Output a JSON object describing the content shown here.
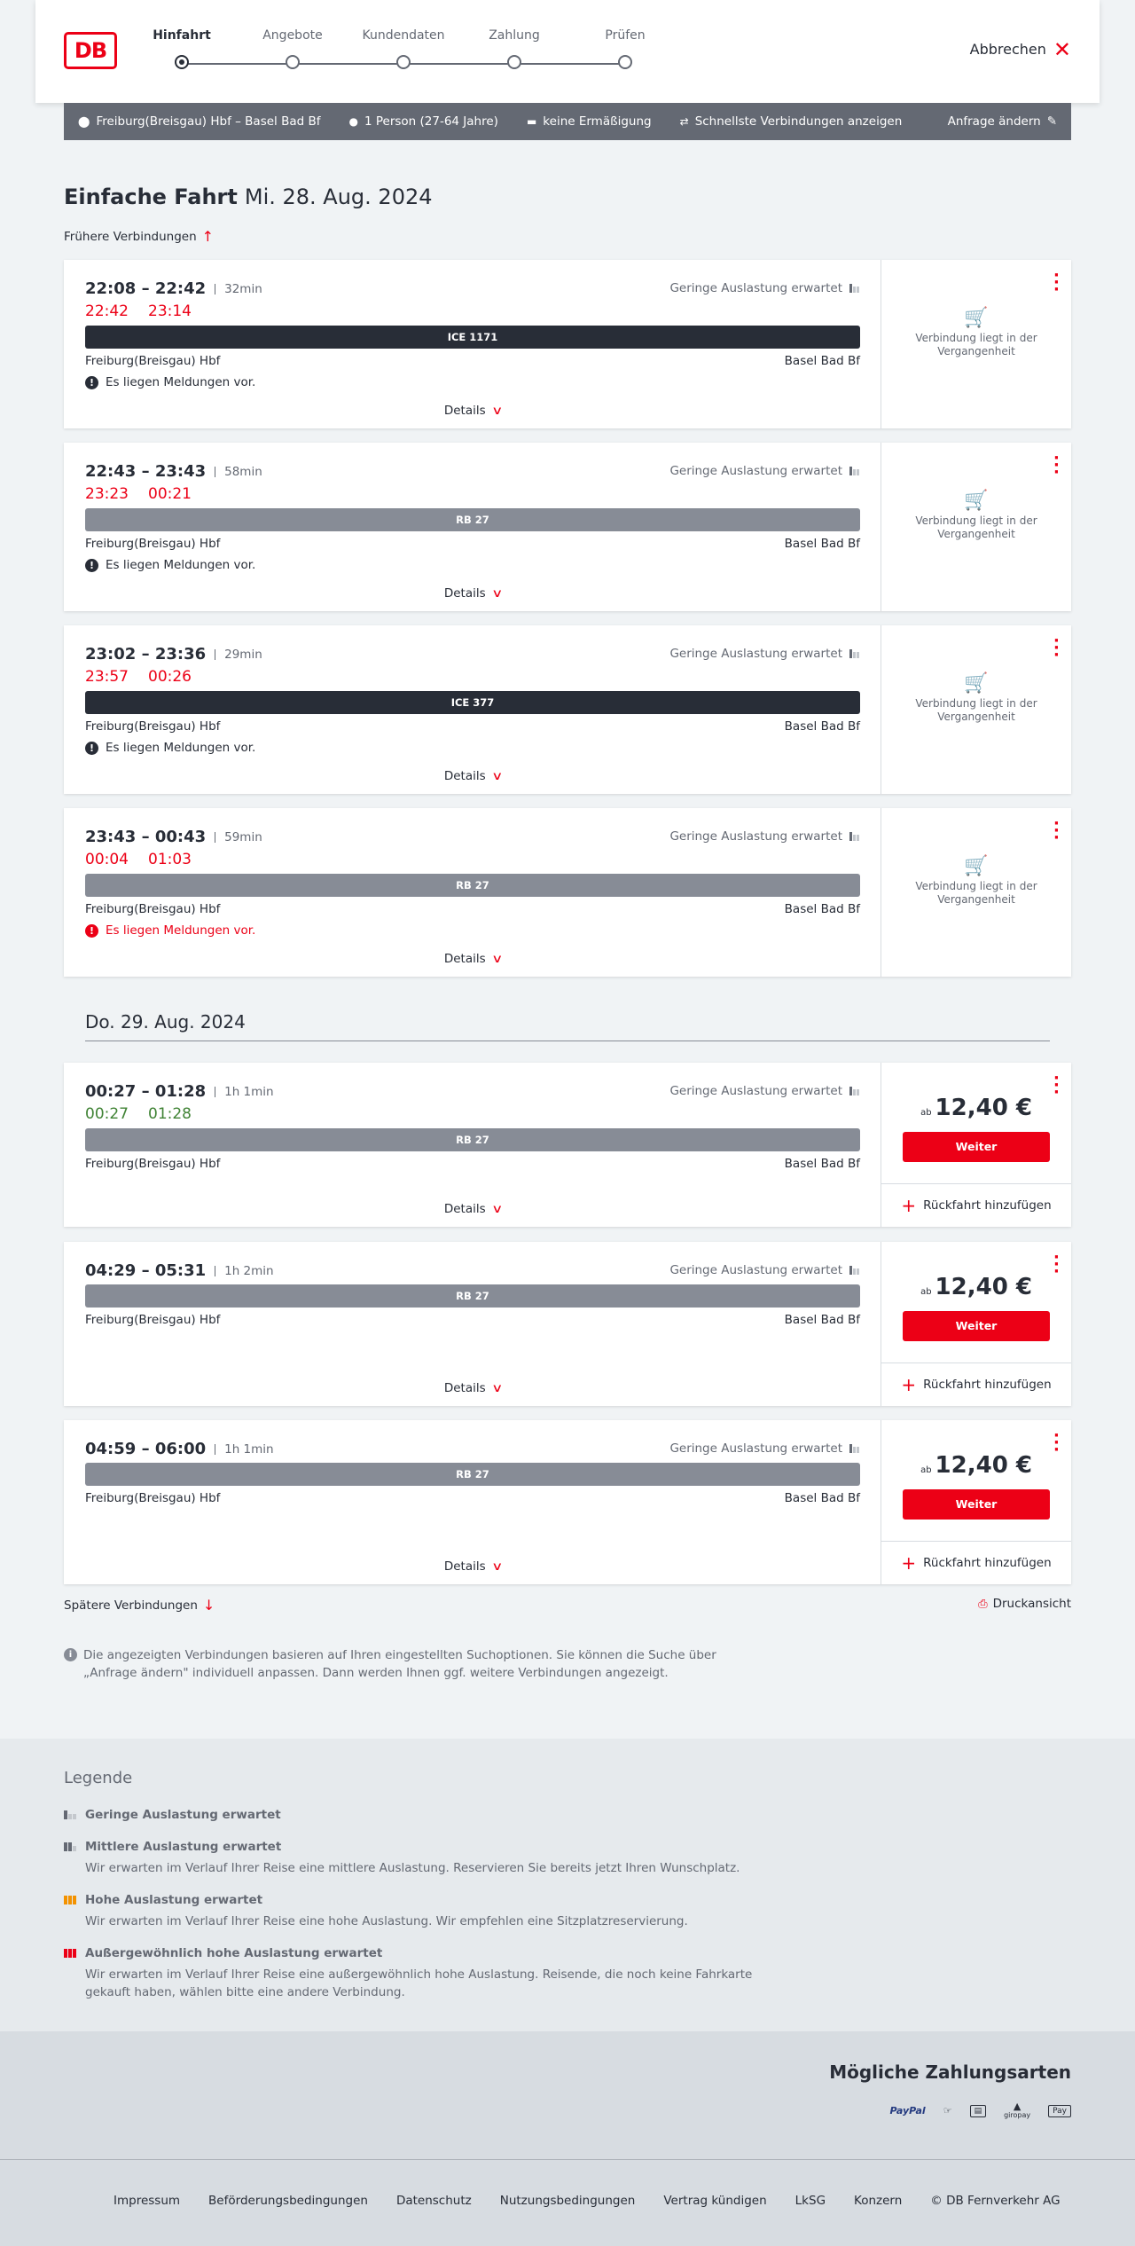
{
  "header": {
    "logo": "DB",
    "steps": [
      {
        "label": "Hinfahrt",
        "active": true
      },
      {
        "label": "Angebote",
        "active": false
      },
      {
        "label": "Kundendaten",
        "active": false
      },
      {
        "label": "Zahlung",
        "active": false
      },
      {
        "label": "Prüfen",
        "active": false
      }
    ],
    "cancel_label": "Abbrechen"
  },
  "search": {
    "route": "Freiburg(Breisgau) Hbf – Basel Bad Bf",
    "passengers": "1 Person (27-64 Jahre)",
    "discount": "keine Ermäßigung",
    "option": "Schnellste Verbindungen anzeigen",
    "edit_label": "Anfrage ändern"
  },
  "page": {
    "title_bold": "Einfache Fahrt",
    "title_date": "Mi. 28. Aug. 2024",
    "earlier_label": "Frühere Verbindungen",
    "date_separator": "Do. 29. Aug. 2024",
    "later_label": "Spätere Verbindungen",
    "print_label": "Druckansicht",
    "info_text": "Die angezeigten Verbindungen basieren auf Ihren eingestellten Suchoptionen. Sie können die Suche über „Anfrage ändern\" individuell anpassen. Dann werden Ihnen ggf. weitere Verbindungen angezeigt."
  },
  "connections": [
    {
      "times": "22:08 – 22:42",
      "duration": "32min",
      "rt_dep": "22:42",
      "rt_arr": "23:14",
      "rt_status": "late",
      "load": "Geringe Auslastung erwartet",
      "train": "ICE 1171",
      "train_style": "dark",
      "from": "Freiburg(Breisgau) Hbf",
      "to": "Basel Bad Bf",
      "message": "Es liegen Meldungen vor.",
      "message_red": false,
      "details": "Details",
      "past": "Verbindung liegt in der Vergangenheit"
    },
    {
      "times": "22:43 – 23:43",
      "duration": "58min",
      "rt_dep": "23:23",
      "rt_arr": "00:21",
      "rt_status": "late",
      "load": "Geringe Auslastung erwartet",
      "train": "RB 27",
      "train_style": "grey",
      "from": "Freiburg(Breisgau) Hbf",
      "to": "Basel Bad Bf",
      "message": "Es liegen Meldungen vor.",
      "message_red": false,
      "details": "Details",
      "past": "Verbindung liegt in der Vergangenheit"
    },
    {
      "times": "23:02 – 23:36",
      "duration": "29min",
      "rt_dep": "23:57",
      "rt_arr": "00:26",
      "rt_status": "late",
      "load": "Geringe Auslastung erwartet",
      "train": "ICE 377",
      "train_style": "dark",
      "from": "Freiburg(Breisgau) Hbf",
      "to": "Basel Bad Bf",
      "message": "Es liegen Meldungen vor.",
      "message_red": false,
      "details": "Details",
      "past": "Verbindung liegt in der Vergangenheit"
    },
    {
      "times": "23:43 – 00:43",
      "duration": "59min",
      "rt_dep": "00:04",
      "rt_arr": "01:03",
      "rt_status": "late",
      "load": "Geringe Auslastung erwartet",
      "train": "RB 27",
      "train_style": "grey",
      "from": "Freiburg(Breisgau) Hbf",
      "to": "Basel Bad Bf",
      "message": "Es liegen Meldungen vor.",
      "message_red": true,
      "details": "Details",
      "past": "Verbindung liegt in der Vergangenheit"
    },
    {
      "times": "00:27 – 01:28",
      "duration": "1h 1min",
      "rt_dep": "00:27",
      "rt_arr": "01:28",
      "rt_status": "ontime",
      "load": "Geringe Auslastung erwartet",
      "train": "RB 27",
      "train_style": "grey",
      "from": "Freiburg(Breisgau) Hbf",
      "to": "Basel Bad Bf",
      "details": "Details",
      "price_prefix": "ab",
      "price": "12,40 €",
      "button": "Weiter",
      "return": "Rückfahrt hinzufügen"
    },
    {
      "times": "04:29 – 05:31",
      "duration": "1h 2min",
      "load": "Geringe Auslastung erwartet",
      "train": "RB 27",
      "train_style": "grey",
      "from": "Freiburg(Breisgau) Hbf",
      "to": "Basel Bad Bf",
      "details": "Details",
      "price_prefix": "ab",
      "price": "12,40 €",
      "button": "Weiter",
      "return": "Rückfahrt hinzufügen"
    },
    {
      "times": "04:59 – 06:00",
      "duration": "1h 1min",
      "load": "Geringe Auslastung erwartet",
      "train": "RB 27",
      "train_style": "grey",
      "from": "Freiburg(Breisgau) Hbf",
      "to": "Basel Bad Bf",
      "details": "Details",
      "price_prefix": "ab",
      "price": "12,40 €",
      "button": "Weiter",
      "return": "Rückfahrt hinzufügen"
    }
  ],
  "legend": {
    "title": "Legende",
    "items": [
      {
        "title": "Geringe Auslastung erwartet",
        "desc": "",
        "color": "#646973"
      },
      {
        "title": "Mittlere Auslastung erwartet",
        "desc": "Wir erwarten im Verlauf Ihrer Reise eine mittlere Auslastung. Reservieren Sie bereits jetzt Ihren Wunschplatz.",
        "color": "#646973"
      },
      {
        "title": "Hohe Auslastung erwartet",
        "desc": "Wir erwarten im Verlauf Ihrer Reise eine hohe Auslastung. Wir empfehlen eine Sitzplatzreservierung.",
        "color": "#f39200"
      },
      {
        "title": "Außergewöhnlich hohe Auslastung erwartet",
        "desc": "Wir erwarten im Verlauf Ihrer Reise eine außergewöhnlich hohe Auslastung. Reisende, die noch keine Fahrkarte gekauft haben, wählen bitte eine andere Verbindung.",
        "color": "#ec0016"
      }
    ]
  },
  "payments": {
    "title": "Mögliche Zahlungsarten",
    "logos": [
      "PayPal",
      "giropay",
      "Pay"
    ]
  },
  "footer": {
    "links": [
      "Impressum",
      "Beförderungsbedingungen",
      "Datenschutz",
      "Nutzungsbedingungen",
      "Vertrag kündigen",
      "LkSG",
      "Konzern",
      "© DB Fernverkehr AG"
    ]
  },
  "colors": {
    "accent": "#ec0016",
    "delay": "#ec0016",
    "ontime": "#408335",
    "dark": "#282d37"
  }
}
